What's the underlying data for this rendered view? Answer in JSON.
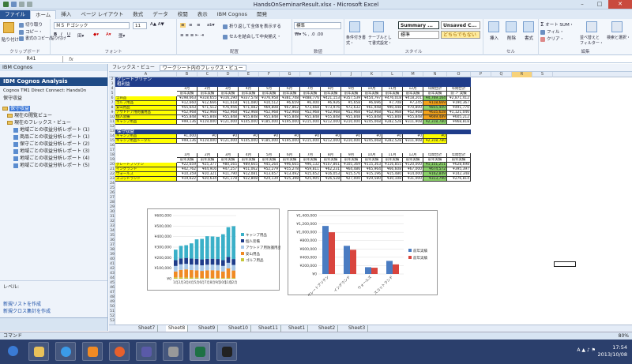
{
  "window": {
    "title": "HandsOnSeminarResult.xlsx - Microsoft Excel"
  },
  "ribbon_tabs": [
    "ファイル",
    "ホーム",
    "挿入",
    "ページ レイアウト",
    "数式",
    "データ",
    "校閲",
    "表示",
    "IBM Cognos",
    "開発"
  ],
  "ribbon": {
    "cut": "切り取り",
    "copy": "コピー・",
    "format_painter": "書式のコピー/貼り付け",
    "paste": "貼り付け",
    "clipboard_label": "クリップボード",
    "font_name": "ＭＳ Ｐゴシック",
    "font_size": "11",
    "font_label": "フォント",
    "wrap_text": "折り返して全体を表示する",
    "merge_center": "セルを結合して中央揃え・",
    "align_label": "配置",
    "number_format": "標準",
    "number_label": "数値",
    "cond_format": "条件付き書式・",
    "table_format": "テーブルとして書式設定・",
    "style_summary": "Summary ...",
    "style_unsaved": "Unsaved C...",
    "style_normal": "標準",
    "style_neutral": "どちらでもない",
    "style_label": "スタイル",
    "insert": "挿入",
    "delete": "削除",
    "format": "書式",
    "cells_label": "セル",
    "autosum": "オート SUM・",
    "fill": "フィル・",
    "clear": "クリア・",
    "sort_filter": "並べ替えとフィルター・",
    "find_select": "検索と選択・",
    "edit_label": "編集"
  },
  "formula_bar": {
    "name_box": "R41",
    "fx": "fx",
    "formula": ""
  },
  "cognos_panel": {
    "title": "IBM Cognos",
    "header": "IBM Cognos Analysis",
    "connection": "Cognos TM1 Direct Connect: HandsOn",
    "package": "保守収益",
    "tree": [
      "保守収益",
      "現在の閲覧ビュー",
      "現在のフレックス・ビュー",
      "地域ごとの収益分析レポート (1)",
      "商品ごとの収益分析レポート (1)",
      "保守ごとの収益分析レポート (2)",
      "地域ごとの収益分析レポート (3)",
      "地域ごとの収益分析レポート (4)",
      "地域ごとの収益分析レポート (5)"
    ],
    "level_label": "レベル:",
    "links": [
      "新規リストを作成",
      "新規クロス集計を作成"
    ]
  },
  "view_toolbar": {
    "label": "フレックス・ビュー",
    "view_name": "ワークシート内のフレックス・ビュー"
  },
  "columns": [
    "A",
    "B",
    "C",
    "D",
    "E",
    "F",
    "G",
    "H",
    "I",
    "J",
    "K",
    "L",
    "M",
    "N",
    "O",
    "P",
    "Q",
    "R",
    "S"
  ],
  "sheet": {
    "title_row": "グレートブリテン",
    "subtitle_row": "粗利益",
    "months": [
      "1月",
      "2月",
      "3月",
      "4月",
      "5月",
      "6月",
      "7月",
      "8月",
      "9月",
      "10月",
      "11月",
      "12月",
      "年間合計",
      "年間合計"
    ],
    "measure": "前年実績",
    "measure_last": "前 ＞ 実績",
    "block1": [
      {
        "label": "全商品",
        "vals": [
          "¥298,663",
          "¥318,655",
          "¥316,290",
          "¥337,578",
          "¥376,958",
          "¥381,748",
          "¥488,776",
          "¥421,153",
          "¥357,539",
          "¥454,797",
          "¥476,018",
          "¥418,201"
        ],
        "total": "¥4,769,164",
        "total2": "¥2,871,412",
        "tcol": "grn"
      },
      {
        "label": "ゴルフ用品",
        "vals": [
          "¥12,660",
          "¥12,666",
          "¥11,618",
          "¥11,080",
          "¥10,512",
          "¥6,659",
          "¥6,400",
          "¥6,926",
          "¥5,658",
          "¥6,696",
          "¥7,708",
          "¥7,245"
        ],
        "total": "¥118,669",
        "total2": "¥190,367",
        "tcol": "org"
      },
      {
        "label": "安山用品",
        "vals": [
          "¥55,643",
          "¥71,512",
          "¥76,956",
          "¥71,082",
          "¥69,808",
          "¥67,862",
          "¥73,668",
          "¥73,976",
          "¥72,632",
          "¥61,948",
          "¥90,448",
          "¥70,800"
        ],
        "total": "¥855,400",
        "total2": "¥491,770",
        "tcol": "grn"
      },
      {
        "label": "アウトドア用防護用品",
        "vals": [
          "¥52,968",
          "¥52,968",
          "¥52,968",
          "¥52,968",
          "¥52,968",
          "¥52,968",
          "¥52,968",
          "¥52,968",
          "¥52,968",
          "¥52,968",
          "¥52,968",
          "¥52,968"
        ],
        "total": "¥635,628",
        "total2": "¥1,121,046",
        "tcol": "org"
      },
      {
        "label": "個人装備",
        "vals": [
          "¥55,848",
          "¥55,848",
          "¥55,848",
          "¥55,848",
          "¥55,848",
          "¥55,848",
          "¥55,848",
          "¥55,848",
          "¥55,848",
          "¥55,848",
          "¥55,848",
          "¥55,848"
        ],
        "total": "¥669,489",
        "total2": "¥605,212",
        "tcol": "org"
      },
      {
        "label": "キャンプ用品",
        "vals": [
          "¥99,136",
          "¥119,000",
          "¥121,000",
          "¥145,000",
          "¥185,000",
          "¥195,000",
          "¥215,000",
          "¥212,000",
          "¥210,000",
          "¥245,068",
          "¥282,528",
          "¥311,908"
        ],
        "total": "¥2,318,780",
        "total2": "¥968,818",
        "tcol": "grn"
      }
    ],
    "band2": "保守収益",
    "block2": [
      {
        "label": "キャンプ用品",
        "vals": [
          "¥1,000",
          "¥0",
          "¥0",
          "¥0",
          "¥0",
          "¥0",
          "¥0",
          "¥0",
          "¥0",
          "¥0",
          "¥0",
          "¥0"
        ],
        "total": "¥0"
      },
      {
        "label": "キャンプ用品トータル",
        "vals": [
          "¥99,136",
          "¥119,000",
          "¥121,000",
          "¥145,000",
          "¥185,000",
          "¥195,000",
          "¥215,000",
          "¥212,000",
          "¥210,000",
          "¥245,068",
          "¥282,528",
          "¥311,908"
        ],
        "total": "¥2,318,780"
      }
    ],
    "block3": [
      {
        "label": "グレートブリテン",
        "vals": [
          "¥22,659",
          "¥25,377",
          "¥80,565",
          "¥89,665",
          "¥45,264",
          "¥96,665",
          "¥96,132",
          "¥107,861",
          "¥105,369",
          "¥115,363",
          "¥116,855",
          "¥120,000"
        ],
        "total": "¥1,151,211",
        "total2": "¥628,698",
        "tcol": "grn"
      },
      {
        "label": "イングランド",
        "vals": [
          "¥42,762",
          "¥44,916",
          "¥47,257",
          "¥51,062",
          "¥52,279",
          "¥55,278",
          "¥59,811",
          "¥62,231",
          "¥64,486",
          "¥65,964",
          "¥66,608",
          "¥67,000"
        ],
        "total": "¥674,572",
        "total2": "¥395,397",
        "tcol": "grn"
      },
      {
        "label": "ウォールズ",
        "vals": [
          "¥10,359",
          "¥10,321",
          "¥11,790",
          "¥12,081",
          "¥13,657",
          "¥13,492",
          "¥15,652",
          "¥16,053",
          "¥15,576",
          "¥15,196",
          "¥15,480",
          "¥14,000"
        ],
        "total": "¥162,849",
        "total2": "¥142,348",
        "tcol": "grn"
      },
      {
        "label": "スコットランド",
        "vals": [
          "¥19,622",
          "¥20,634",
          "¥21,178",
          "¥22,808",
          "¥24,139",
          "¥25,398",
          "¥25,905",
          "¥26,528",
          "¥27,000",
          "¥29,580",
          "¥30,108",
          "¥31,000"
        ],
        "total": "¥313,790",
        "total2": "¥276,814",
        "tcol": "grn"
      }
    ]
  },
  "chart_data": [
    {
      "type": "bar",
      "stacked": true,
      "categories": [
        "1月",
        "2月",
        "3月",
        "4月",
        "5月",
        "6月",
        "7月",
        "8月",
        "9月",
        "10月",
        "11月",
        "12月"
      ],
      "ylim": [
        0,
        600000
      ],
      "yticks": [
        "¥0",
        "¥100,000",
        "¥200,000",
        "¥300,000",
        "¥400,000",
        "¥500,000",
        "¥600,000"
      ],
      "legend": "right",
      "series": [
        {
          "name": "ゴルフ用品",
          "color": "#c7c73a",
          "values": [
            12660,
            12666,
            11618,
            11080,
            10512,
            6659,
            6400,
            6926,
            5658,
            6696,
            7708,
            7245
          ]
        },
        {
          "name": "安山用品",
          "color": "#f08a24",
          "values": [
            55643,
            71512,
            76956,
            71082,
            69808,
            67862,
            73668,
            73976,
            72632,
            61948,
            90448,
            70800
          ]
        },
        {
          "name": "アウトドア用防護用品",
          "color": "#a8c8e8",
          "values": [
            52968,
            52968,
            52968,
            52968,
            52968,
            52968,
            52968,
            52968,
            52968,
            52968,
            52968,
            52968
          ]
        },
        {
          "name": "個人装備",
          "color": "#1f3c8a",
          "values": [
            55848,
            55848,
            55848,
            55848,
            55848,
            55848,
            55848,
            55848,
            55848,
            55848,
            55848,
            55848
          ]
        },
        {
          "name": "キャンプ用品",
          "color": "#3ab0c8",
          "values": [
            99136,
            119000,
            121000,
            145000,
            185000,
            195000,
            215000,
            212000,
            210000,
            245068,
            282528,
            311908
          ]
        }
      ]
    },
    {
      "type": "bar",
      "categories": [
        "グレートブリテン",
        "イングランド",
        "ウォールズ",
        "スコットランド"
      ],
      "ylim": [
        0,
        1400000
      ],
      "yticks": [
        "¥0",
        "¥200,000",
        "¥400,000",
        "¥600,000",
        "¥800,000",
        "¥1,000,000",
        "¥1,200,000",
        "¥1,400,000"
      ],
      "legend": "right",
      "series": [
        {
          "name": "前年実績",
          "color": "#4a7cc2",
          "values": [
            1151211,
            674572,
            162849,
            313790
          ]
        },
        {
          "name": "前年実績",
          "color": "#d9453e",
          "values": [
            1000000,
            580000,
            150000,
            230000
          ]
        }
      ]
    }
  ],
  "sheet_tabs": [
    "Sheet7",
    "Sheet8",
    "Sheet9",
    "Sheet10",
    "Sheet11",
    "Sheet1",
    "Sheet2",
    "Sheet3"
  ],
  "active_tab": "Sheet8",
  "status": {
    "mode": "コマンド",
    "zoom": "80%"
  },
  "taskbar": {
    "time": "17:54",
    "date": "2013/10/08"
  }
}
